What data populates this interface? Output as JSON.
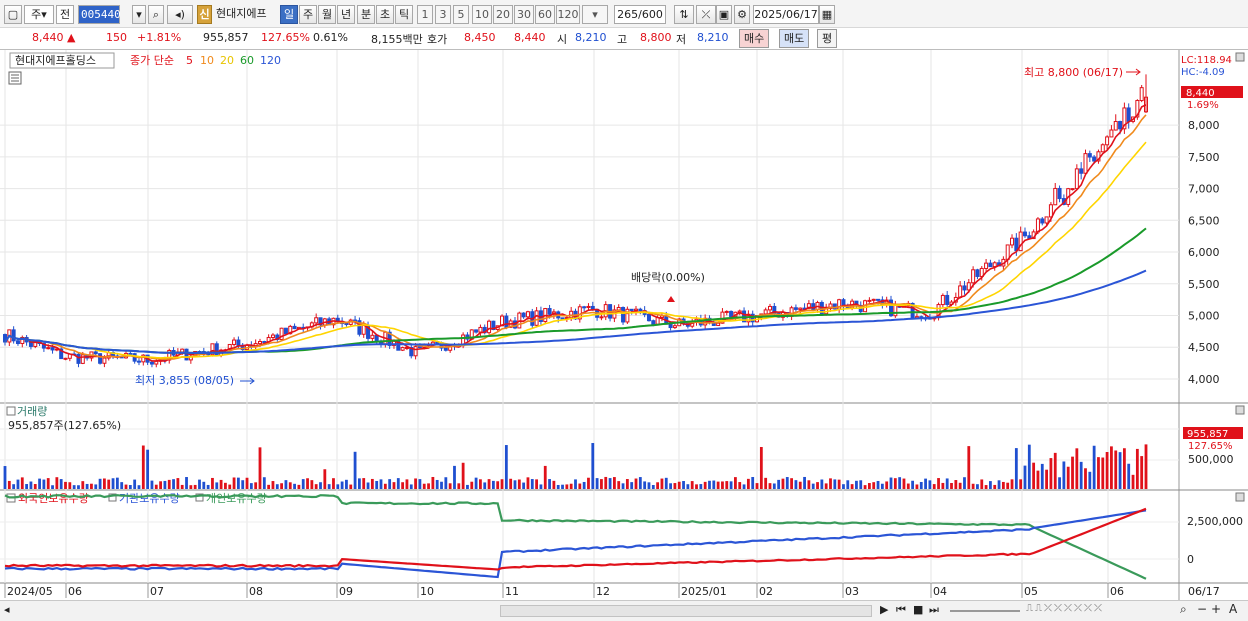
{
  "toolbar": {
    "market_type": "주",
    "market_sub": "전",
    "stock_code": "005440",
    "badge": "신",
    "stock_name": "현대지에프",
    "periods": [
      "일",
      "주",
      "월",
      "년",
      "분",
      "초",
      "틱"
    ],
    "selected_period": "일",
    "intervals": [
      "1",
      "3",
      "5",
      "10",
      "20",
      "30",
      "60",
      "120"
    ],
    "count": "265",
    "count_max": "/600",
    "date": "2025/06/17"
  },
  "quote": {
    "price": "8,440",
    "change_arrow": "▲",
    "change": "150",
    "change_rate": "+1.81%",
    "volume": "955,857",
    "volume_ratio": "127.65%",
    "turnover": "0.61%",
    "amount": "8,155백만",
    "hoga_label": "호가",
    "ask": "8,450",
    "bid": "8,440",
    "open_label": "시",
    "open": "8,210",
    "high_label": "고",
    "high": "8,800",
    "low_label": "저",
    "low": "8,210",
    "buy_btn": "매수",
    "sell_btn": "매도",
    "eval_btn": "평"
  },
  "price_panel": {
    "stock_title": "현대지에프홀딩스",
    "ma_title": "종가 단순",
    "ma_periods": [
      "5",
      "10",
      "20",
      "60",
      "120"
    ],
    "ma_colors": [
      "#e0111a",
      "#f08a1c",
      "#ffd500",
      "#1a9a2a",
      "#2b55d6"
    ],
    "lc_label": "LC:118.94",
    "hc_label": "HC:-4.09",
    "current_price_tag": "8,440",
    "current_rate_tag": "1.69%",
    "y_ticks": [
      "8,000",
      "7,500",
      "7,000",
      "6,500",
      "6,000",
      "5,500",
      "5,000",
      "4,500",
      "4,000"
    ],
    "high_annotation": "최고 8,800 (06/17)",
    "low_annotation": "최저 3,855 (08/05)",
    "dividend_annotation": "배당락(0.00%)"
  },
  "volume_panel": {
    "title": "거래량",
    "value_label": "955,857주(127.65%)",
    "tag_volume": "955,857",
    "tag_rate": "127.65%",
    "y_tick": "500,000"
  },
  "holdings_panel": {
    "legend": [
      {
        "label": "외국인보유수량",
        "color": "#e0111a"
      },
      {
        "label": "기관보유수량",
        "color": "#2b55d6"
      },
      {
        "label": "개인보유수량",
        "color": "#3a9a5a"
      }
    ],
    "y_ticks": [
      "2,500,000",
      "0"
    ]
  },
  "x_axis": {
    "labels": [
      "2024/05",
      "06",
      "07",
      "08",
      "09",
      "10",
      "11",
      "12",
      "2025/01",
      "02",
      "03",
      "04",
      "05",
      "06"
    ],
    "end_label": "06/17"
  },
  "chart_data": {
    "type": "candlestick",
    "price_range": [
      3700,
      8900
    ],
    "volume_range": [
      0,
      1500000
    ],
    "ma_latest": {
      "ma5": 8050,
      "ma10": 8000,
      "ma20": 7500,
      "ma60": 6080,
      "ma120": 5560
    },
    "monthly_close_approx": [
      {
        "x": "2024/05",
        "close": 4700
      },
      {
        "x": "06",
        "close": 4350
      },
      {
        "x": "07",
        "close": 4300
      },
      {
        "x": "08",
        "close": 4550
      },
      {
        "x": "09",
        "close": 4950
      },
      {
        "x": "10",
        "close": 4400
      },
      {
        "x": "11",
        "close": 4900
      },
      {
        "x": "12",
        "close": 5100
      },
      {
        "x": "2025/01",
        "close": 4850
      },
      {
        "x": "02",
        "close": 5000
      },
      {
        "x": "03",
        "close": 5200
      },
      {
        "x": "04",
        "close": 5050
      },
      {
        "x": "05",
        "close": 6200
      },
      {
        "x": "06/17",
        "close": 8440
      }
    ],
    "high": {
      "value": 8800,
      "date": "06/17"
    },
    "low": {
      "value": 3855,
      "date": "08/05"
    },
    "latest_volume": 955857
  }
}
